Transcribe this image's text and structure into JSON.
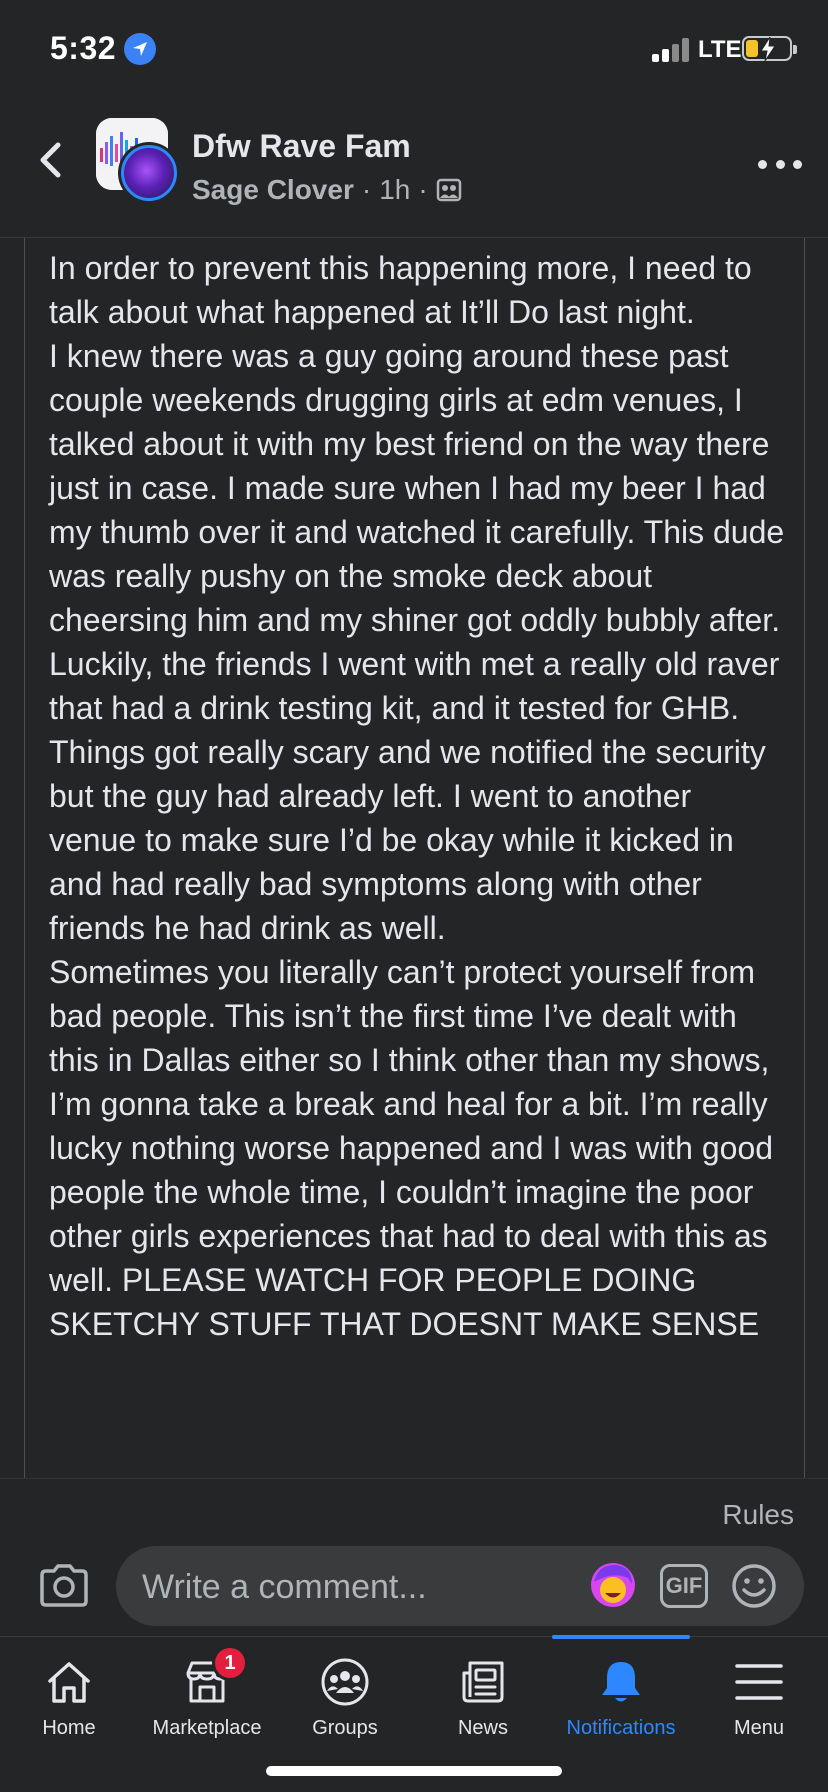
{
  "status_bar": {
    "time": "5:32",
    "network": "LTE",
    "icons": [
      "location-arrow-icon",
      "signal-bars-icon",
      "battery-charging-icon"
    ]
  },
  "header": {
    "group_name": "Dfw Rave Fam",
    "author": "Sage Clover",
    "time_ago": "1h",
    "separator": "·",
    "icons": [
      "back-chevron-icon",
      "group-avatar",
      "user-avatar",
      "audience-icon",
      "more-dots-icon"
    ]
  },
  "post": {
    "paragraphs": [
      "In order to prevent this happening more, I need to talk about what happened at It’ll Do last night.",
      "I knew there was a guy going around these past couple weekends drugging girls at edm venues, I talked about it with my best friend on the way there just in case. I made sure when I had my beer I had my thumb over it and watched it carefully. This dude was really pushy on the smoke deck about cheersing him and my shiner got oddly bubbly after. Luckily, the friends I went with met a really old raver that had a drink testing kit, and it tested for GHB. Things got really scary and we notified the security but the guy had already left. I went to another venue to make sure I’d be okay while it kicked in and had really bad symptoms along with other friends he had drink as well.",
      "Sometimes you literally can’t protect yourself from bad people. This isn’t the first time I’ve dealt with this in Dallas either so I think other than my shows, I’m gonna take a break and heal for a bit. I’m really lucky nothing worse happened and I was with good people the whole time, I couldn’t imagine the poor other girls experiences that had to deal with this as well. PLEASE WATCH FOR PEOPLE DOING SKETCHY STUFF THAT DOESNT MAKE SENSE"
    ]
  },
  "comment_bar": {
    "rules_label": "Rules",
    "placeholder": "Write a comment...",
    "gif_label": "GIF",
    "icons": [
      "camera-icon",
      "avatar-sticker-icon",
      "gif-icon",
      "emoji-icon"
    ]
  },
  "tabs": [
    {
      "label": "Home",
      "icon": "home-icon"
    },
    {
      "label": "Marketplace",
      "icon": "marketplace-icon",
      "badge": "1"
    },
    {
      "label": "Groups",
      "icon": "groups-icon"
    },
    {
      "label": "News",
      "icon": "news-icon"
    },
    {
      "label": "Notifications",
      "icon": "bell-icon",
      "active": true
    },
    {
      "label": "Menu",
      "icon": "menu-icon"
    }
  ],
  "colors": {
    "background": "#242526",
    "text": "#e4e6eb",
    "secondary_text": "#b0b3b8",
    "accent": "#2d88ff",
    "badge": "#e41e3f"
  }
}
